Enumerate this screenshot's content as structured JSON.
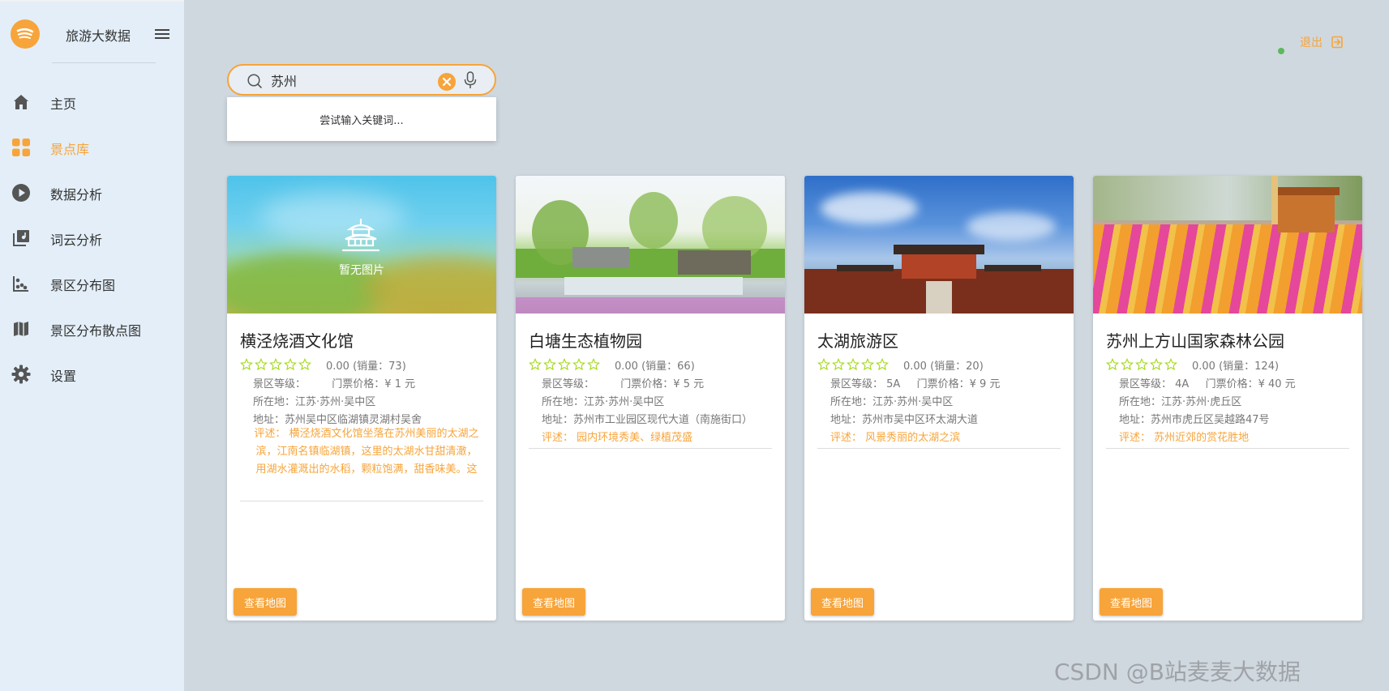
{
  "sidebar": {
    "brand_title": "旅游大数据",
    "items": [
      {
        "label": "主页",
        "icon": "home-icon",
        "active": false
      },
      {
        "label": "景点库",
        "icon": "grid-icon",
        "active": true
      },
      {
        "label": "数据分析",
        "icon": "play-circle-icon",
        "active": false
      },
      {
        "label": "词云分析",
        "icon": "photo-library-icon",
        "active": false
      },
      {
        "label": "景区分布图",
        "icon": "scatter-icon",
        "active": false
      },
      {
        "label": "景区分布散点图",
        "icon": "map-icon",
        "active": false
      },
      {
        "label": "设置",
        "icon": "gear-icon",
        "active": false
      }
    ]
  },
  "header": {
    "logout_label": "退出"
  },
  "search": {
    "value": "苏州",
    "suggestion": "尝试输入关键词..."
  },
  "colors": {
    "accent": "#f7a43a",
    "sidebar_bg": "#e3eef8",
    "page_bg": "#cfd8df"
  },
  "cards": [
    {
      "title": "横泾烧酒文化馆",
      "no_image_label": "暂无图片",
      "rating_text": "0.00 (销量：73)",
      "level_label": "景区等级：",
      "level_value": "",
      "price_label": "门票价格：¥ 1 元",
      "location": "所在地：江苏·苏州·吴中区",
      "address": "地址：苏州吴中区临湖镇灵湖村吴舍",
      "desc": "评述：  横泾烧酒文化馆坐落在苏州美丽的太湖之滨，江南名镇临湖镇，这里的太湖水甘甜清澈，用湖水灌溉出的水稻，颗粒饱满，甜香味美。这",
      "button": "查看地图"
    },
    {
      "title": "白塘生态植物园",
      "rating_text": "0.00 (销量：66)",
      "level_label": "景区等级：",
      "level_value": "",
      "price_label": "门票价格：¥ 5 元",
      "location": "所在地：江苏·苏州·吴中区",
      "address": "地址：苏州市工业园区现代大道（南施街口）",
      "desc": "评述：  园内环境秀美、绿植茂盛",
      "button": "查看地图"
    },
    {
      "title": "太湖旅游区",
      "rating_text": "0.00 (销量：20)",
      "level_label": "景区等级：",
      "level_value": "5A",
      "price_label": "门票价格：¥ 9 元",
      "location": "所在地：江苏·苏州·吴中区",
      "address": "地址：苏州市吴中区环太湖大道",
      "desc": "评述：  风景秀丽的太湖之滨",
      "button": "查看地图"
    },
    {
      "title": "苏州上方山国家森林公园",
      "rating_text": "0.00 (销量：124)",
      "level_label": "景区等级：",
      "level_value": "4A",
      "price_label": "门票价格：¥ 40 元",
      "location": "所在地：江苏·苏州·虎丘区",
      "address": "地址：苏州市虎丘区吴越路47号",
      "desc": "评述：  苏州近郊的赏花胜地",
      "button": "查看地图"
    }
  ],
  "watermark": "CSDN @B站麦麦大数据"
}
